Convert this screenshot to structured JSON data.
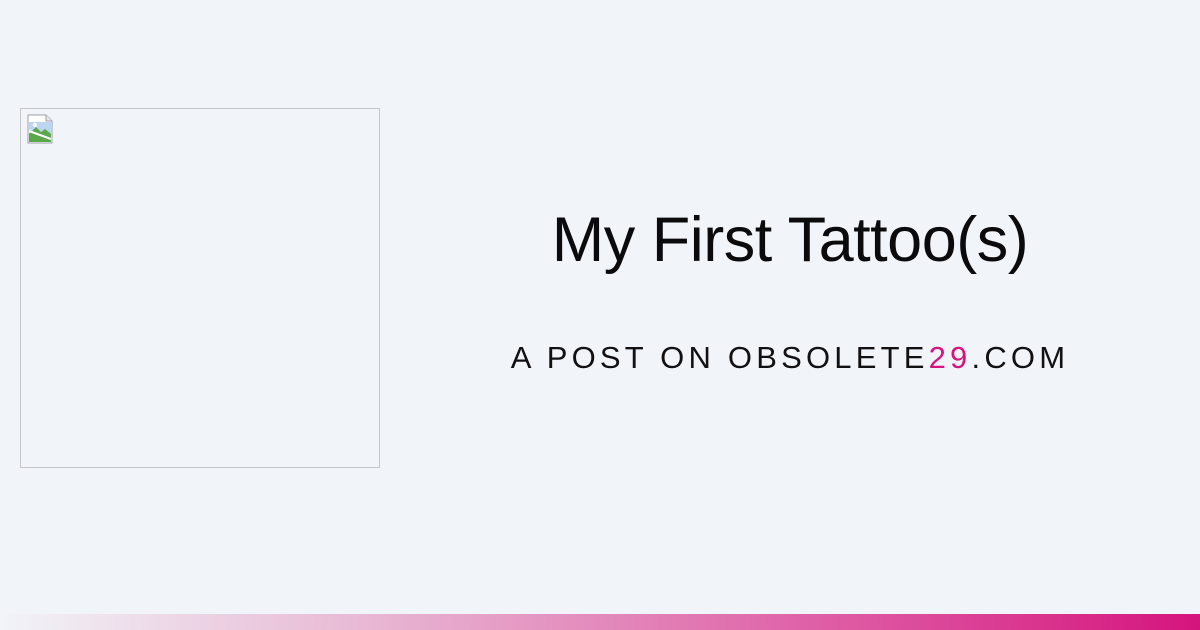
{
  "post": {
    "title": "My First Tattoo(s)",
    "subtitle_prefix": "A POST ON OBSOLETE",
    "subtitle_accent": "29",
    "subtitle_suffix": ".COM"
  },
  "image": {
    "icon": "broken-image-icon"
  },
  "colors": {
    "background": "#f1f4f8",
    "accent": "#d5147d",
    "text": "#0b0b0d"
  }
}
